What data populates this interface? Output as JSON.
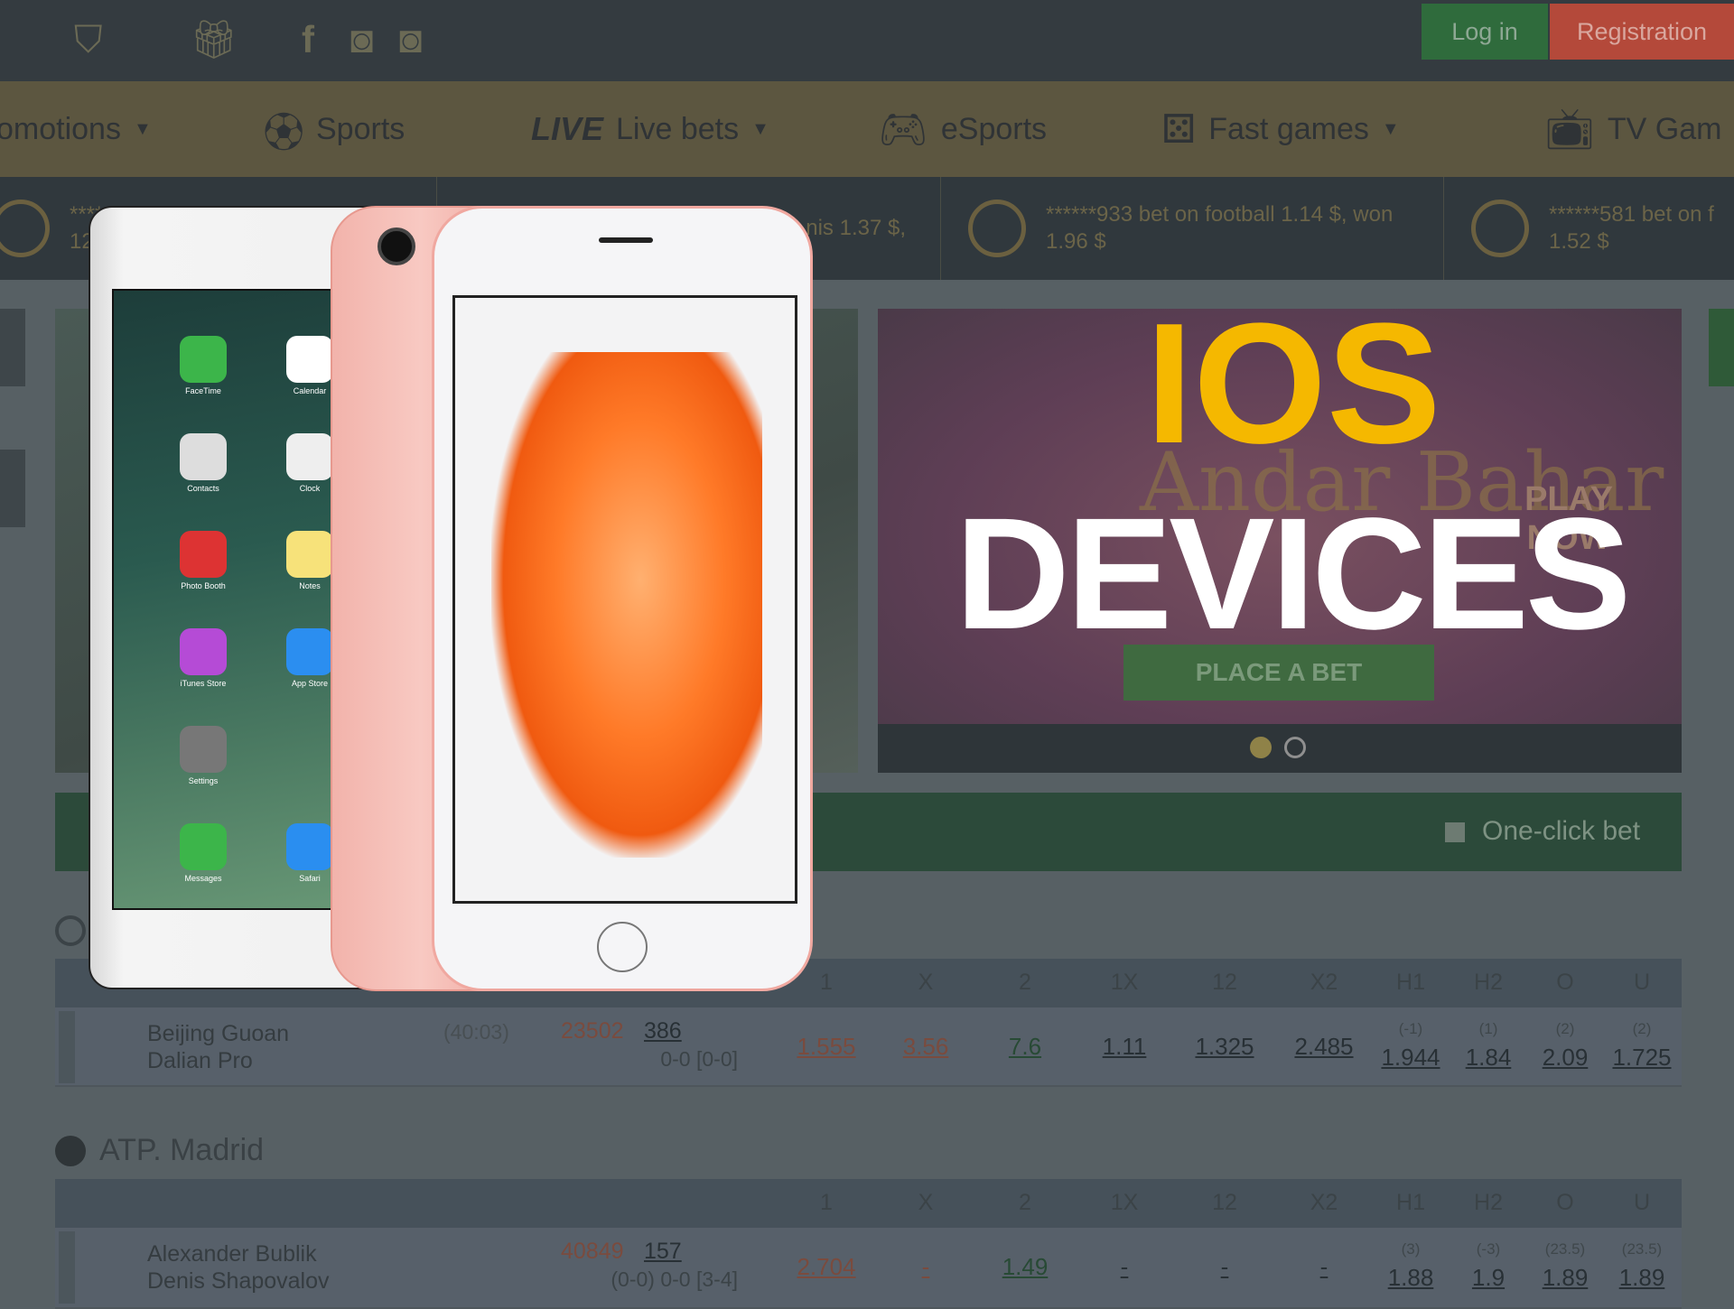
{
  "header": {
    "icons": [
      "shield-icon",
      "gift-icon",
      "facebook-icon",
      "instagram-icon",
      "instagram-icon"
    ],
    "login": "Log in",
    "registration": "Registration"
  },
  "nav": {
    "promotions": "omotions",
    "sports": "Sports",
    "live_badge": "LIVE",
    "live_bets": "Live bets",
    "esports": "eSports",
    "fast_games": "Fast games",
    "tv_games": "TV Gam"
  },
  "ticker": [
    {
      "l1": "******",
      "l2": "129"
    },
    {
      "l1": "nis 1.37 $,",
      "l2": ""
    },
    {
      "l1": "******933 bet on football 1.14 $, won",
      "l2": "1.96 $"
    },
    {
      "l1": "******581 bet on f",
      "l2": "1.52 $"
    }
  ],
  "banner": {
    "game": "Andar Bahar",
    "play_now": "PLAY NOW",
    "place_bet": "PLACE A BET"
  },
  "overlay": {
    "line1": "IOS",
    "line2": "DEVICES"
  },
  "one_click": "One-click bet",
  "columns": [
    "1",
    "X",
    "2",
    "1X",
    "12",
    "X2",
    "H1",
    "H2",
    "O",
    "U"
  ],
  "matches": [
    {
      "team1": "Beijing Guoan",
      "team2": "Dalian Pro",
      "time": "(40:03)",
      "id": "23502",
      "count": "386",
      "score": "0-0 [0-0]",
      "odds": [
        "1.555",
        "3.56",
        "7.6",
        "1.11",
        "1.325",
        "2.485",
        "1.944",
        "1.84",
        "2.09",
        "1.725"
      ],
      "params": [
        "(-1)",
        "(1)",
        "(2)",
        "(2)"
      ]
    },
    {
      "team1": "Alexander Bublik",
      "team2": "Denis Shapovalov",
      "time": "",
      "id": "40849",
      "count": "157",
      "score": "(0-0) 0-0 [3-4]",
      "odds": [
        "2.704",
        "-",
        "1.49",
        "-",
        "-",
        "-",
        "1.88",
        "1.9",
        "1.89",
        "1.89"
      ],
      "params": [
        "(3)",
        "(-3)",
        "(23.5)",
        "(23.5)"
      ]
    }
  ],
  "league2": "ATP. Madrid",
  "ipad_apps": [
    "FaceTime",
    "Calendar",
    "Contacts",
    "Clock",
    "Photo Booth",
    "Notes",
    "iTunes Store",
    "App Store",
    "Settings",
    "",
    "Messages",
    "Safari"
  ],
  "colors": {
    "ios": "#f5b800",
    "green": "#2f6b3c",
    "red": "#b4493a"
  }
}
